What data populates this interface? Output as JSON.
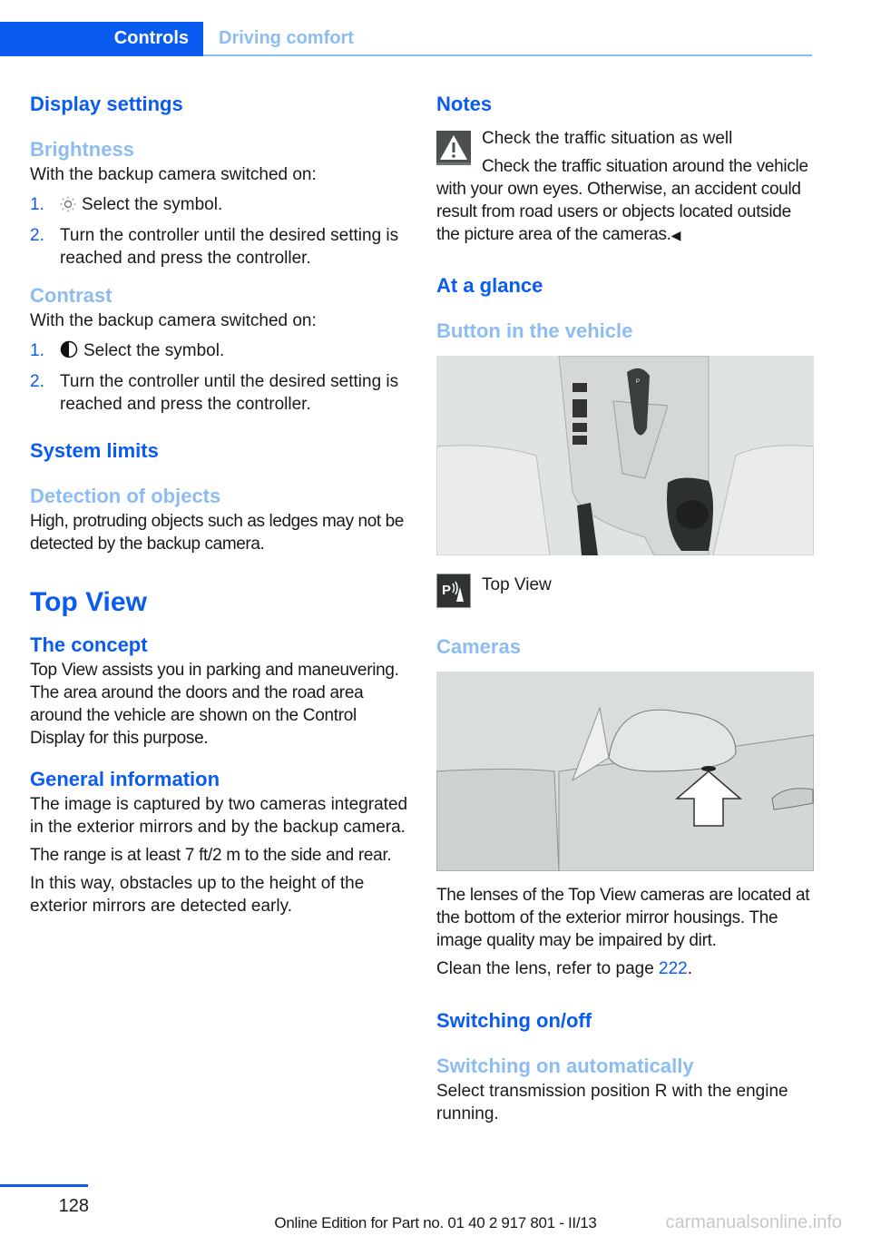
{
  "header": {
    "active_tab": "Controls",
    "section_tab": "Driving comfort"
  },
  "left": {
    "display_settings": "Display settings",
    "brightness": {
      "heading": "Brightness",
      "intro": "With the backup camera switched on:",
      "steps": [
        {
          "num": "1.",
          "icon": "brightness-sun-icon",
          "text": "Select the symbol."
        },
        {
          "num": "2.",
          "text": "Turn the controller until the desired setting is reached and press the controller."
        }
      ]
    },
    "contrast": {
      "heading": "Contrast",
      "intro": "With the backup camera switched on:",
      "steps": [
        {
          "num": "1.",
          "icon": "contrast-half-circle-icon",
          "text": "Select the symbol."
        },
        {
          "num": "2.",
          "text": "Turn the controller until the desired setting is reached and press the controller."
        }
      ]
    },
    "system_limits": "System limits",
    "detection": {
      "heading": "Detection of objects",
      "text": "High, protruding objects such as ledges may not be detected by the backup camera."
    },
    "top_view_title": "Top View",
    "concept": {
      "heading": "The concept",
      "text": "Top View assists you in parking and maneuvering. The area around the doors and the road area around the vehicle are shown on the Control Display for this purpose."
    },
    "general": {
      "heading": "General information",
      "paragraphs": [
        "The image is captured by two cameras integrated in the exterior mirrors and by the backup camera.",
        "The range is at least 7 ft/2 m to the side and rear.",
        "In this way, obstacles up to the height of the exterior mirrors are detected early."
      ]
    }
  },
  "right": {
    "notes": {
      "heading": "Notes",
      "warning_title": "Check the traffic situation as well",
      "warning_text": "Check the traffic situation around the vehicle with your own eyes. Otherwise, an accident could result from road users or objects located outside the picture area of the cameras.",
      "end_mark": "◀"
    },
    "at_a_glance": "At a glance",
    "button_in_vehicle": "Button in the vehicle",
    "button_image_alt": "Center console with gear selector and iDrive controller",
    "top_view_button_label": "Top View",
    "cameras_heading": "Cameras",
    "camera_image_alt": "Exterior mirror with arrow pointing to camera lens",
    "cameras_text": "The lenses of the Top View cameras are located at the bottom of the exterior mirror housings. The image quality may be impaired by dirt.",
    "clean_text": "Clean the lens, refer to page ",
    "clean_page": "222",
    "clean_end": ".",
    "switching": "Switching on/off",
    "switching_auto": {
      "heading": "Switching on automatically",
      "text": "Select transmission position R with the engine running."
    }
  },
  "footer": {
    "page_number": "128",
    "edition": "Online Edition for Part no. 01 40 2 917 801 - II/13",
    "watermark": "carmanualsonline.info"
  },
  "colors": {
    "primary_blue": "#0a5bf0",
    "light_blue": "#8cbcf2",
    "text": "#1a1a1a"
  }
}
